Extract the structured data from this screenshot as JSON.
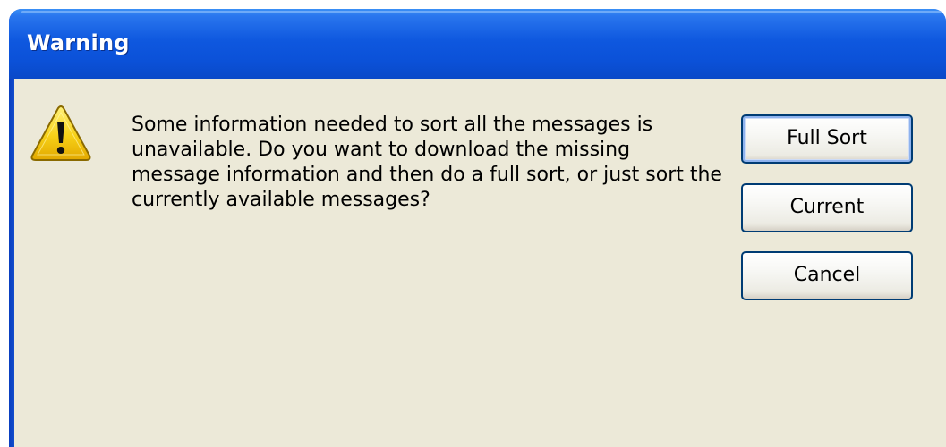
{
  "window": {
    "title": "Warning"
  },
  "dialog": {
    "icon": "warning-icon",
    "message": "Some information needed to sort all the messages is unavailable. Do you want to download the missing message information and then do a full sort, or just sort the currently available messages?",
    "buttons": {
      "full_sort": "Full Sort",
      "current": "Current",
      "cancel": "Cancel"
    }
  },
  "colors": {
    "titlebar": "#0b51d8",
    "dialog_bg": "#ece9d8",
    "button_border": "#003c74",
    "warning_yellow": "#f7d117"
  }
}
